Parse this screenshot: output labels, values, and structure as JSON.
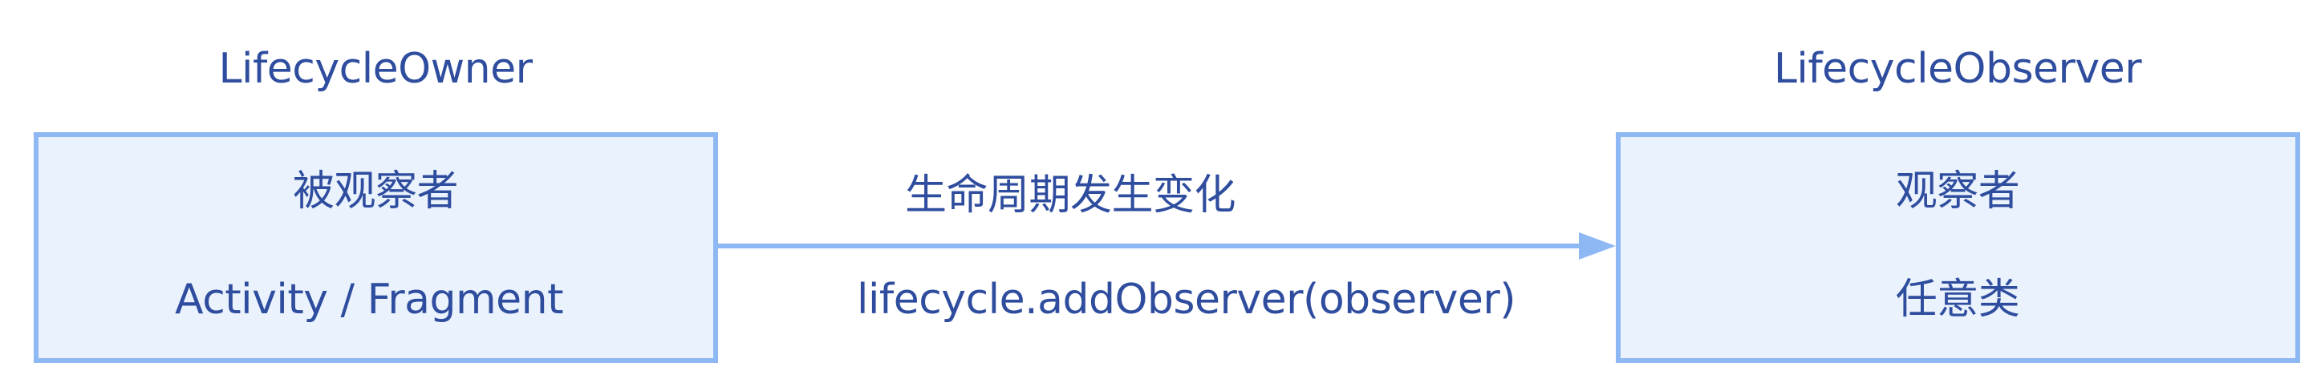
{
  "owner": {
    "heading": "LifecycleOwner",
    "role": "被观察者",
    "types": "Activity / Fragment"
  },
  "observer": {
    "heading": "LifecycleObserver",
    "role": "观察者",
    "types": "任意类"
  },
  "connection": {
    "event_label": "生命周期发生变化",
    "method_label": "lifecycle.addObserver(observer)"
  },
  "colors": {
    "text": "#2f4d9e",
    "box_fill": "#eaf2fd",
    "box_border": "#8db8f4",
    "arrow": "#8db8f4"
  }
}
